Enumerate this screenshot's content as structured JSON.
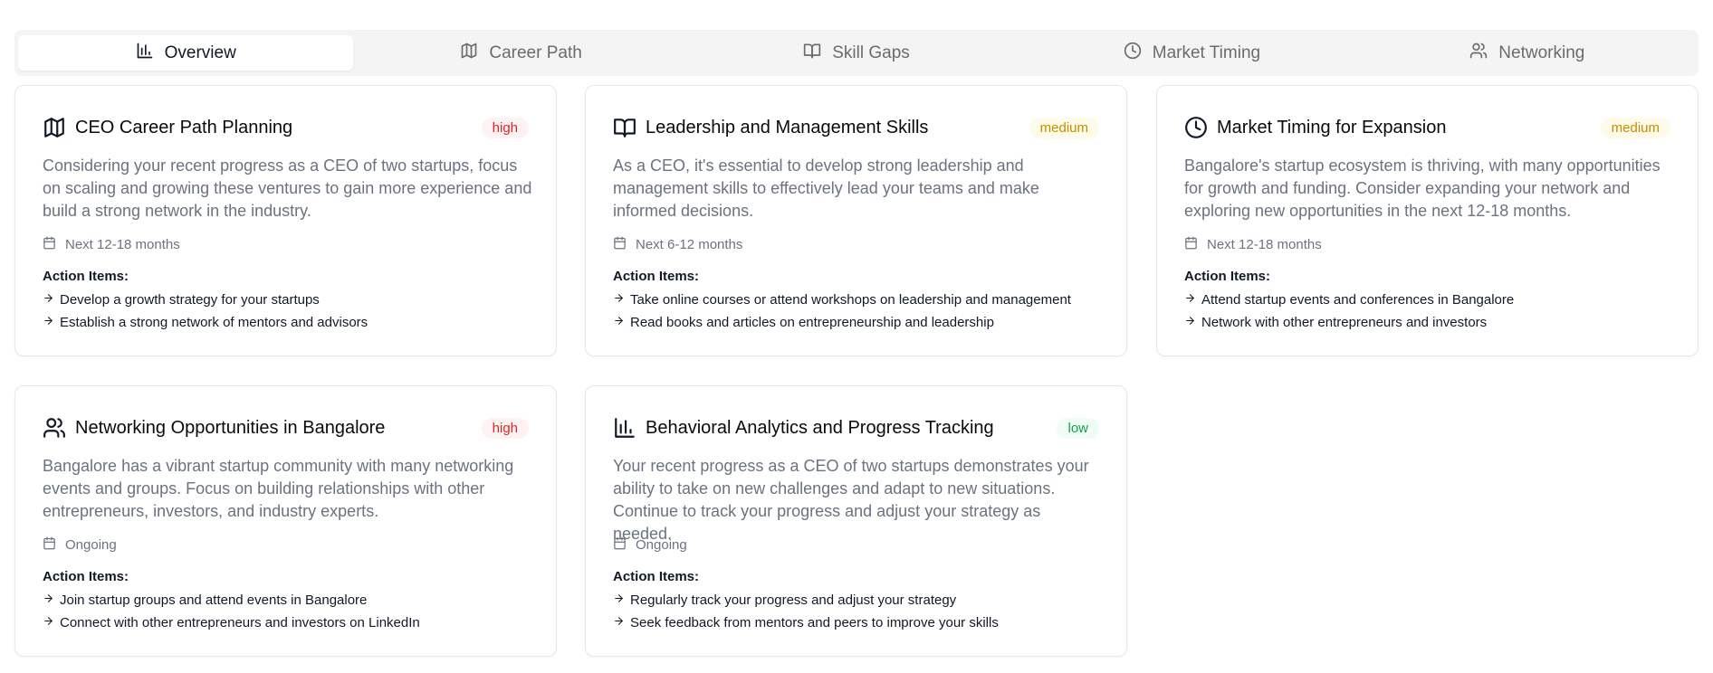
{
  "tabs": [
    {
      "label": "Overview",
      "icon": "bar-chart-icon",
      "active": true
    },
    {
      "label": "Career Path",
      "icon": "map-icon",
      "active": false
    },
    {
      "label": "Skill Gaps",
      "icon": "book-open-icon",
      "active": false
    },
    {
      "label": "Market Timing",
      "icon": "clock-icon",
      "active": false
    },
    {
      "label": "Networking",
      "icon": "users-icon",
      "active": false
    }
  ],
  "actions_label": "Action Items:",
  "cards": [
    {
      "icon": "map-icon",
      "title": "CEO Career Path Planning",
      "priority": "high",
      "description": "Considering your recent progress as a CEO of two startups, focus on scaling and growing these ventures to gain more experience and build a strong network in the industry.",
      "timeline": "Next 12-18 months",
      "actions": [
        "Develop a growth strategy for your startups",
        "Establish a strong network of mentors and advisors"
      ]
    },
    {
      "icon": "book-open-icon",
      "title": "Leadership and Management Skills",
      "priority": "medium",
      "description": "As a CEO, it's essential to develop strong leadership and management skills to effectively lead your teams and make informed decisions.",
      "timeline": "Next 6-12 months",
      "actions": [
        "Take online courses or attend workshops on leadership and management",
        "Read books and articles on entrepreneurship and leadership"
      ]
    },
    {
      "icon": "clock-icon",
      "title": "Market Timing for Expansion",
      "priority": "medium",
      "description": "Bangalore's startup ecosystem is thriving, with many opportunities for growth and funding. Consider expanding your network and exploring new opportunities in the next 12-18 months.",
      "timeline": "Next 12-18 months",
      "actions": [
        "Attend startup events and conferences in Bangalore",
        "Network with other entrepreneurs and investors"
      ]
    },
    {
      "icon": "users-icon",
      "title": "Networking Opportunities in Bangalore",
      "priority": "high",
      "description": "Bangalore has a vibrant startup community with many networking events and groups. Focus on building relationships with other entrepreneurs, investors, and industry experts.",
      "timeline": "Ongoing",
      "actions": [
        "Join startup groups and attend events in Bangalore",
        "Connect with other entrepreneurs and investors on LinkedIn"
      ]
    },
    {
      "icon": "bar-chart-icon",
      "title": "Behavioral Analytics and Progress Tracking",
      "priority": "low",
      "description": "Your recent progress as a CEO of two startups demonstrates your ability to take on new challenges and adapt to new situations. Continue to track your progress and adjust your strategy as needed.",
      "timeline": "Ongoing",
      "actions": [
        "Regularly track your progress and adjust your strategy",
        "Seek feedback from mentors and peers to improve your skills"
      ]
    }
  ]
}
